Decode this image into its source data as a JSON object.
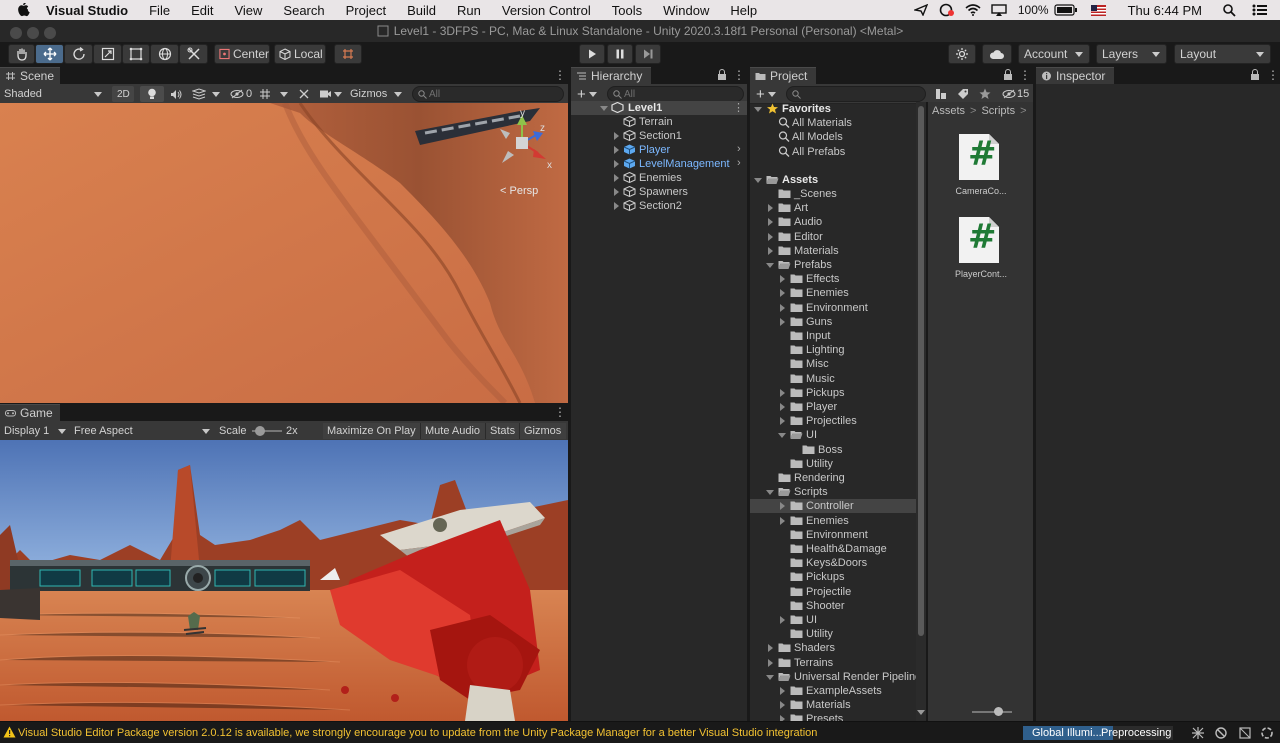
{
  "menubar": {
    "app": "Visual Studio",
    "items": [
      "File",
      "Edit",
      "View",
      "Search",
      "Project",
      "Build",
      "Run",
      "Version Control",
      "Tools",
      "Window",
      "Help"
    ],
    "battery": "100%",
    "clock": "Thu 6:44 PM"
  },
  "window": {
    "title": "Level1 - 3DFPS - PC, Mac & Linux Standalone - Unity 2020.3.18f1 Personal (Personal) <Metal>"
  },
  "toolbar": {
    "pivot": "Center",
    "space": "Local",
    "account": "Account",
    "layers": "Layers",
    "layout": "Layout"
  },
  "scene": {
    "tab": "Scene",
    "shading": "Shaded",
    "mode_2d": "2D",
    "hidden_count": "0",
    "gizmos": "Gizmos",
    "search_placeholder": "All",
    "persp": "Persp",
    "axis_y": "y",
    "axis_z": "z",
    "axis_x": "x"
  },
  "game": {
    "tab": "Game",
    "display": "Display 1",
    "aspect": "Free Aspect",
    "scale_label": "Scale",
    "scale_value": "2x",
    "scale_level": 0.15,
    "maximize": "Maximize On Play",
    "mute": "Mute Audio",
    "stats": "Stats",
    "gizmos": "Gizmos"
  },
  "hierarchy": {
    "tab": "Hierarchy",
    "search_placeholder": "All",
    "scene_name": "Level1",
    "items": [
      "Terrain",
      "Section1",
      "Player",
      "LevelManagement",
      "Enemies",
      "Spawners",
      "Section2"
    ]
  },
  "project": {
    "tab": "Project",
    "hidden_count": "15",
    "favorites": {
      "label": "Favorites",
      "items": [
        "All Materials",
        "All Models",
        "All Prefabs"
      ]
    },
    "assets_label": "Assets",
    "tree": [
      "_Scenes",
      "Art",
      "Audio",
      "Editor",
      "Materials",
      "Prefabs",
      "Effects",
      "Enemies",
      "Environment",
      "Guns",
      "Input",
      "Lighting",
      "Misc",
      "Music",
      "Pickups",
      "Player",
      "Projectiles",
      "UI",
      "Boss",
      "Utility",
      "Rendering",
      "Scripts",
      "Controller",
      "Enemies",
      "Environment",
      "Health&Damage",
      "Keys&Doors",
      "Pickups",
      "Projectile",
      "Shooter",
      "UI",
      "Utility",
      "Shaders",
      "Terrains",
      "Universal Render Pipeline",
      "ExampleAssets",
      "Materials",
      "Presets"
    ],
    "breadcrumb": [
      "Assets",
      "Scripts"
    ],
    "files": [
      {
        "name": "CameraCo...",
        "glyph": "#"
      },
      {
        "name": "PlayerCont...",
        "glyph": "#"
      }
    ]
  },
  "inspector": {
    "tab": "Inspector"
  },
  "status": {
    "message": "Visual Studio Editor Package version 2.0.12 is available, we strongly encourage you to update from the Unity Package Manager for a better Visual Studio integration",
    "gi_label": "Global Illumi...",
    "gi_status": "Preprocessing",
    "gi_progress": 0.6
  },
  "colors": {
    "selection": "#2f5f8c",
    "sand": "#cf7549",
    "sky": "#4f78b8",
    "gun_red": "#c4201c",
    "script_green": "#1f7a35"
  }
}
